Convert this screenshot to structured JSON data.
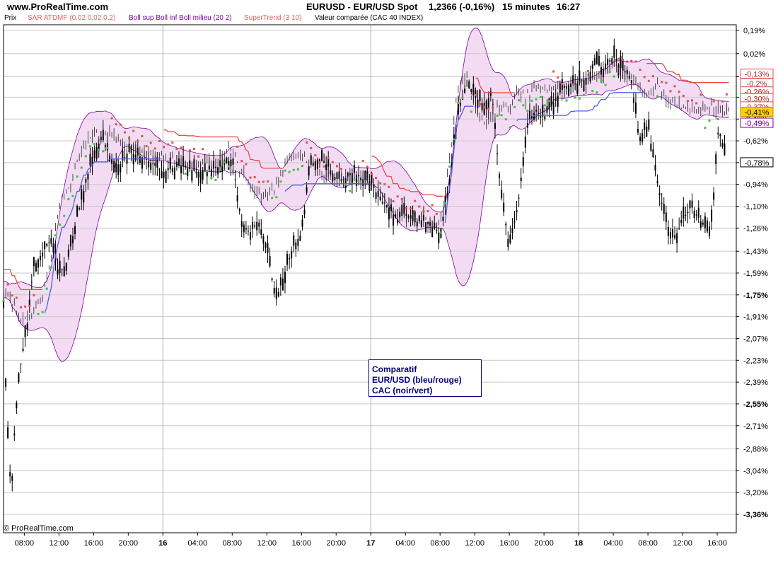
{
  "header": {
    "site": "www.ProRealTime.com",
    "instrument": "EURUSD - EUR/USD Spot",
    "quote": "1,2366 (-0,16%)",
    "period": "15 minutes",
    "time": "16:27"
  },
  "legend": [
    {
      "text": "Prix",
      "color": "#000000"
    },
    {
      "text": "SAR ATDMF (0,02 0,02 0,2)",
      "color": "#e06060"
    },
    {
      "text": "Boll sup Boll inf Boll milieu (20 2)",
      "color": "#8000a0"
    },
    {
      "text": "SuperTrend (3 10)",
      "color": "#e06060"
    },
    {
      "text": "Valeur comparée (CAC 40 INDEX)",
      "color": "#000000"
    }
  ],
  "annotation": {
    "line1": "Comparatif",
    "line2": "EUR/USD (bleu/rouge)",
    "line3": "CAC (noir/vert)"
  },
  "copyright": "© ProRealTime.com",
  "colors": {
    "eurusd_line": "#5060e0",
    "supertrend": "#e84848",
    "sar_red": "#e05050",
    "sar_green": "#40c040",
    "bollinger": "#8000a0",
    "bollinger_fill": "#f3dcf3",
    "cac": "#000000",
    "current_value_bg": "#ffd000",
    "grid": "#c8c8c8"
  },
  "chart_data": {
    "type": "line",
    "title": "EURUSD - EUR/USD Spot",
    "ylabel": "",
    "ylim": [
      -3.42,
      0.24
    ],
    "yticks": [
      "0,19%",
      "0,02%",
      "-0,15%",
      "-0,30%",
      "-0,46%",
      "-0,62%",
      "-0,78%",
      "-0,94%",
      "-1,10%",
      "-1,26%",
      "-1,43%",
      "-1,59%",
      "-1,75%",
      "-1,91%",
      "-2,07%",
      "-2,23%",
      "-2,39%",
      "-2,55%",
      "-2,71%",
      "-2,88%",
      "-3,04%",
      "-3,20%",
      "-3,36%"
    ],
    "ytick_values": [
      0.19,
      0.02,
      -0.15,
      -0.3,
      -0.46,
      -0.62,
      -0.78,
      -0.94,
      -1.1,
      -1.26,
      -1.43,
      -1.59,
      -1.75,
      -1.91,
      -2.07,
      -2.23,
      -2.39,
      -2.55,
      -2.71,
      -2.88,
      -3.04,
      -3.2,
      -3.36
    ],
    "bold_yticks": [
      "-1,75%",
      "-2,55%",
      "-3,36%"
    ],
    "xticks": [
      "08:00",
      "12:00",
      "16:00",
      "20:00",
      "16",
      "04:00",
      "08:00",
      "12:00",
      "16:00",
      "20:00",
      "17",
      "04:00",
      "08:00",
      "12:00",
      "16:00",
      "20:00",
      "18",
      "04:00",
      "08:00",
      "12:00",
      "16:00"
    ],
    "xtick_hours": [
      8,
      12,
      16,
      20,
      24,
      28,
      32,
      36,
      40,
      44,
      48,
      52,
      56,
      60,
      64,
      68,
      72,
      76,
      80,
      84,
      88
    ],
    "day_separators": [
      24,
      48,
      72
    ],
    "xlim_hours": [
      5.6,
      90.2
    ],
    "value_labels": [
      {
        "text": "-0,13%",
        "value": -0.13,
        "style": "red"
      },
      {
        "text": "-0,2%",
        "value": -0.2,
        "style": "red"
      },
      {
        "text": "-0,26%",
        "value": -0.26,
        "style": "red"
      },
      {
        "text": "-0,30%",
        "value": -0.31,
        "style": "red"
      },
      {
        "text": "-0,37%",
        "value": -0.37,
        "style": "red"
      },
      {
        "text": "-0,41%",
        "value": -0.41,
        "style": "current"
      },
      {
        "text": "-0,49%",
        "value": -0.49,
        "style": "purple"
      },
      {
        "text": "-0,78%",
        "value": -0.78,
        "style": "black"
      }
    ],
    "series": [
      {
        "key": "eurusd_close",
        "x": [
          5.6,
          7,
          8,
          9,
          10,
          11,
          12,
          13,
          14,
          15,
          16,
          17,
          18,
          19,
          20,
          22,
          24,
          26,
          28,
          30,
          31,
          32,
          33,
          34,
          35,
          36,
          37,
          38,
          39,
          40,
          41,
          42,
          43,
          44,
          45,
          46,
          47,
          48,
          49,
          50,
          51,
          52,
          53,
          54,
          55,
          56,
          57,
          58,
          59,
          60,
          61,
          62,
          63,
          64,
          65,
          66,
          67,
          68,
          69,
          70,
          71,
          72,
          73,
          74,
          75,
          76,
          77,
          78,
          79,
          80,
          81,
          82,
          83,
          84,
          85,
          86,
          87,
          88,
          89,
          89.4
        ],
        "y": [
          -1.7,
          -1.85,
          -1.95,
          -1.9,
          -1.78,
          -1.5,
          -1.1,
          -0.98,
          -0.8,
          -0.65,
          -0.55,
          -0.6,
          -0.55,
          -0.62,
          -0.65,
          -0.72,
          -0.75,
          -0.78,
          -0.8,
          -0.78,
          -0.7,
          -0.68,
          -0.85,
          -0.95,
          -1.0,
          -1.05,
          -0.95,
          -0.8,
          -0.72,
          -0.7,
          -0.78,
          -0.86,
          -0.88,
          -0.9,
          -0.88,
          -0.85,
          -0.86,
          -0.92,
          -1.0,
          -1.1,
          -1.15,
          -1.2,
          -1.18,
          -1.22,
          -1.2,
          -1.25,
          -0.8,
          -0.25,
          -0.15,
          -0.35,
          -0.5,
          -0.45,
          -0.35,
          -0.4,
          -0.25,
          -0.3,
          -0.22,
          -0.25,
          -0.22,
          -0.28,
          -0.2,
          -0.2,
          -0.18,
          -0.15,
          -0.1,
          -0.05,
          -0.15,
          -0.15,
          -0.22,
          -0.28,
          -0.2,
          -0.3,
          -0.36,
          -0.38,
          -0.4,
          -0.38,
          -0.36,
          -0.4,
          -0.41,
          -0.38
        ]
      },
      {
        "key": "cac_close",
        "x": [
          5.6,
          6,
          6.5,
          7,
          7.5,
          8,
          8.5,
          9,
          10,
          11,
          12,
          13,
          14,
          15,
          16,
          17,
          18,
          19,
          20,
          22,
          24,
          26,
          28,
          30,
          31,
          32,
          33,
          34,
          35,
          36,
          37,
          38,
          39,
          40,
          41,
          42,
          43,
          44,
          45,
          46,
          47,
          48,
          49,
          50,
          51,
          52,
          53,
          54,
          55,
          56,
          57,
          58,
          59,
          60,
          61,
          62,
          63,
          64,
          65,
          66,
          67,
          68,
          69,
          70,
          71,
          72,
          73,
          74,
          75,
          76,
          77,
          78,
          79,
          80,
          81,
          82,
          83,
          84,
          85,
          86,
          87,
          87.6,
          88,
          88.5,
          89
        ],
        "y": [
          -1.8,
          -2.7,
          -3.2,
          -2.6,
          -2.3,
          -2.1,
          -1.9,
          -1.55,
          -1.45,
          -1.35,
          -1.6,
          -1.5,
          -1.2,
          -0.95,
          -0.7,
          -0.6,
          -0.75,
          -0.8,
          -0.7,
          -0.75,
          -0.85,
          -0.8,
          -0.85,
          -0.82,
          -0.8,
          -0.75,
          -1.2,
          -1.3,
          -1.2,
          -1.4,
          -1.8,
          -1.6,
          -1.4,
          -1.3,
          -0.8,
          -0.75,
          -0.8,
          -0.9,
          -0.9,
          -0.85,
          -0.9,
          -0.92,
          -1.05,
          -1.1,
          -1.2,
          -1.15,
          -1.22,
          -1.2,
          -1.25,
          -1.3,
          -0.95,
          -0.45,
          -0.2,
          -0.3,
          -0.35,
          -0.28,
          -1.0,
          -1.4,
          -1.1,
          -0.5,
          -0.4,
          -0.45,
          -0.35,
          -0.25,
          -0.2,
          -0.2,
          -0.15,
          -0.05,
          -0.1,
          0.0,
          -0.1,
          -0.15,
          -0.6,
          -0.5,
          -0.9,
          -1.2,
          -1.35,
          -1.2,
          -1.1,
          -1.2,
          -1.3,
          -1.0,
          -0.55,
          -0.6,
          -0.78
        ]
      }
    ]
  }
}
